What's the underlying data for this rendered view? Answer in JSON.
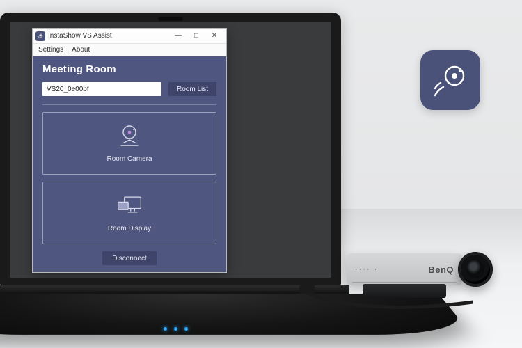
{
  "window": {
    "title": "InstaShow VS Assist",
    "controls": {
      "minimize": "—",
      "maximize": "□",
      "close": "✕"
    }
  },
  "menu": {
    "settings": "Settings",
    "about": "About"
  },
  "panel": {
    "heading": "Meeting Room",
    "room_value": "VS20_0e00bf",
    "room_list_label": "Room List"
  },
  "cards": {
    "camera_label": "Room Camera",
    "display_label": "Room Display"
  },
  "footer": {
    "disconnect_label": "Disconnect"
  },
  "webcam": {
    "brand": "BenQ",
    "ports": "···· ·"
  }
}
